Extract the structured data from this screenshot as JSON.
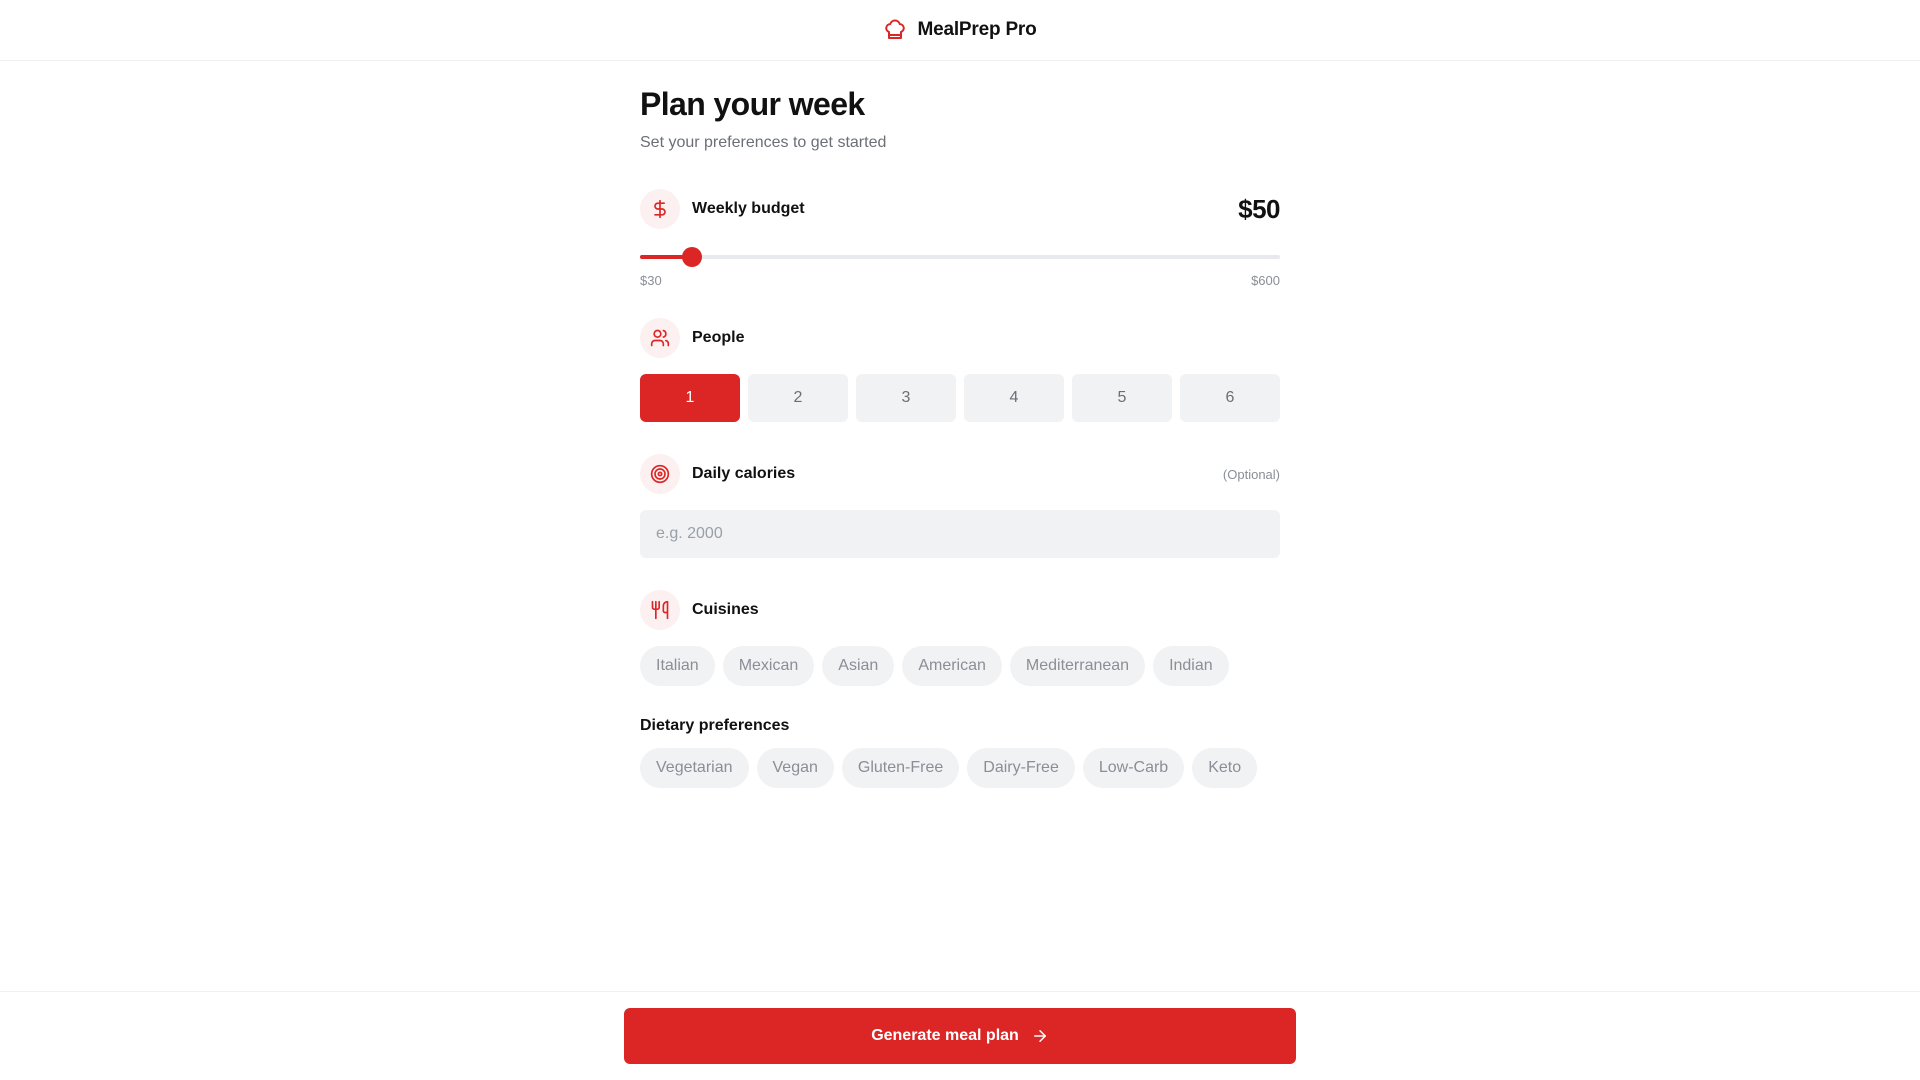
{
  "header": {
    "app_title": "MealPrep Pro",
    "logo_icon": "chef-hat-icon"
  },
  "page": {
    "title": "Plan your week",
    "subtitle": "Set your preferences to get started"
  },
  "budget": {
    "label": "Weekly budget",
    "icon": "dollar-icon",
    "value_label": "$50",
    "value": 50,
    "min": 30,
    "max": 600,
    "min_label": "$30",
    "max_label": "$600"
  },
  "people": {
    "label": "People",
    "icon": "users-icon",
    "options": [
      "1",
      "2",
      "3",
      "4",
      "5",
      "6"
    ],
    "selected": "1"
  },
  "calories": {
    "label": "Daily calories",
    "icon": "target-icon",
    "optional_label": "(Optional)",
    "placeholder": "e.g. 2000",
    "value": ""
  },
  "cuisines": {
    "label": "Cuisines",
    "icon": "utensils-icon",
    "options": [
      "Italian",
      "Mexican",
      "Asian",
      "American",
      "Mediterranean",
      "Indian"
    ]
  },
  "dietary": {
    "label": "Dietary preferences",
    "options": [
      "Vegetarian",
      "Vegan",
      "Gluten-Free",
      "Dairy-Free",
      "Low-Carb",
      "Keto"
    ]
  },
  "cta": {
    "label": "Generate meal plan",
    "icon": "arrow-right-icon"
  },
  "colors": {
    "accent": "#dc2626",
    "accent_soft": "#fdf0f0",
    "chip_bg": "#f1f2f4",
    "muted_text": "#8a8e96"
  }
}
